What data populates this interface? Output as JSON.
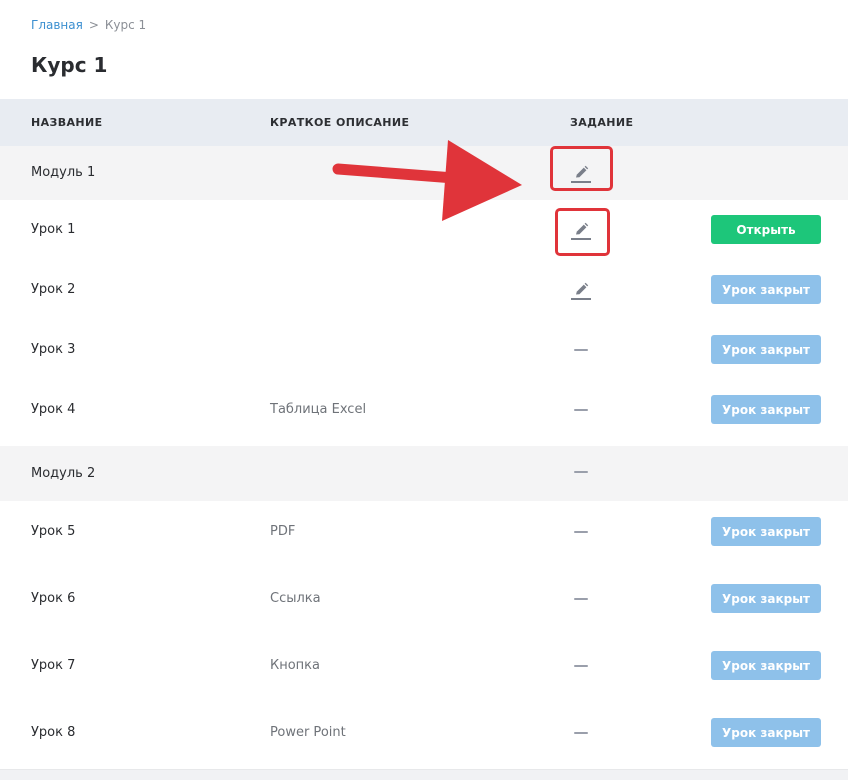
{
  "breadcrumb": {
    "home": "Главная",
    "separator": ">",
    "current": "Курс 1"
  },
  "page_title": "Курс 1",
  "table": {
    "headers": {
      "name": "НАЗВАНИЕ",
      "description": "КРАТКОЕ ОПИСАНИЕ",
      "task": "ЗАДАНИЕ"
    },
    "rows": [
      {
        "kind": "module",
        "name": "Модуль 1",
        "description": "",
        "task_icon": "pencil-icon",
        "button": ""
      },
      {
        "kind": "lesson",
        "name": "Урок 1",
        "description": "",
        "task_icon": "pencil-icon",
        "button": "Открыть"
      },
      {
        "kind": "lesson",
        "name": "Урок 2",
        "description": "",
        "task_icon": "pencil-icon",
        "button": "Урок закрыт"
      },
      {
        "kind": "lesson",
        "name": "Урок 3",
        "description": "",
        "task_icon": "dash-icon",
        "button": "Урок закрыт"
      },
      {
        "kind": "lesson",
        "name": "Урок 4",
        "description": "Таблица Excel",
        "task_icon": "dash-icon",
        "button": "Урок закрыт"
      },
      {
        "kind": "module",
        "name": "Модуль 2",
        "description": "",
        "task_icon": "dash-icon",
        "button": ""
      },
      {
        "kind": "lesson",
        "name": "Урок 5",
        "description": "PDF",
        "task_icon": "dash-icon",
        "button": "Урок закрыт"
      },
      {
        "kind": "lesson",
        "name": "Урок 6",
        "description": "Ссылка",
        "task_icon": "dash-icon",
        "button": "Урок закрыт"
      },
      {
        "kind": "lesson",
        "name": "Урок 7",
        "description": "Кнопка",
        "task_icon": "dash-icon",
        "button": "Урок закрыт"
      },
      {
        "kind": "lesson",
        "name": "Урок 8",
        "description": "Power Point",
        "task_icon": "dash-icon",
        "button": "Урок закрыт"
      }
    ]
  },
  "colors": {
    "open_button": "#1dc67a",
    "closed_button": "#8ec1ea",
    "annotation": "#e0343a",
    "link": "#3b8fd0"
  }
}
